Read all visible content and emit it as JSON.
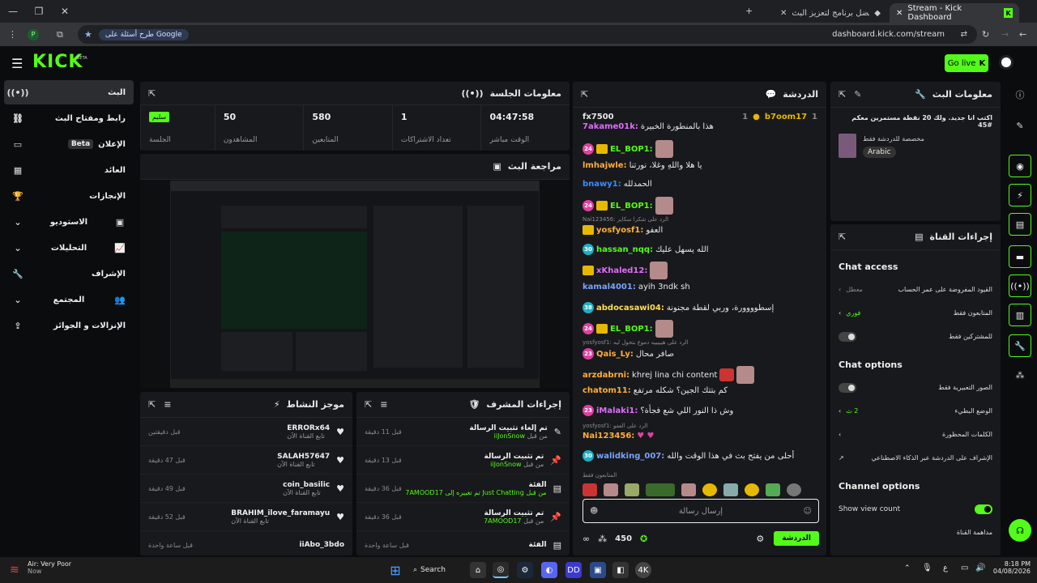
{
  "browser": {
    "tabs": [
      {
        "label": "Stream - Kick Dashboard",
        "active": true
      },
      {
        "label": "الولاء | أفضل برنامج لتعزيز البث",
        "active": false
      }
    ],
    "search_chip": "طرح أسئلة على Google",
    "url": "dashboard.kick.com/stream"
  },
  "header": {
    "logo": "KICK",
    "logo_sup": "BETA",
    "go_live": "Go live"
  },
  "sidebar": {
    "items": [
      {
        "label": "البث",
        "icon": "radio-icon",
        "active": true
      },
      {
        "label": "رابط ومفتاح البث",
        "icon": "link-icon"
      },
      {
        "label": "الإعلان",
        "icon": "ad-icon",
        "badge": "Beta"
      },
      {
        "label": "العائد",
        "icon": "revenue-icon"
      },
      {
        "label": "الإنجازات",
        "icon": "trophy-icon"
      },
      {
        "label": "الاستوديو",
        "icon": "studio-icon",
        "expand": true
      },
      {
        "label": "التحليلات",
        "icon": "chart-icon",
        "expand": true
      },
      {
        "label": "الإشراف",
        "icon": "wrench-icon"
      },
      {
        "label": "المجتمع",
        "icon": "community-icon",
        "expand": true
      },
      {
        "label": "الإنزالات و الجوائز",
        "icon": "gift-icon"
      }
    ]
  },
  "session": {
    "title": "معلومات الجلسة",
    "status_badge": "سليم",
    "status_label": "الجلسة",
    "stats": [
      {
        "value": "04:47:58",
        "label": "الوقت مباشر"
      },
      {
        "value": "1",
        "label": "تعداد الاشتراكات"
      },
      {
        "value": "580",
        "label": "المتابعين"
      },
      {
        "value": "50",
        "label": "المشاهدون"
      }
    ]
  },
  "preview": {
    "title": "مراجعة البث"
  },
  "activity": {
    "title": "موجز النشاط",
    "items": [
      {
        "name": "ERRORx64",
        "sub": "تابع القناة الآن",
        "time": "قبل دقيقتين"
      },
      {
        "name": "SALAH57647",
        "sub": "تابع القناة الآن",
        "time": "قبل 47 دقيقة"
      },
      {
        "name": "coin_basilic",
        "sub": "تابع القناة الآن",
        "time": "قبل 49 دقيقة"
      },
      {
        "name": "BRAHIM_ilove_faramayu",
        "sub": "تابع القناة الآن",
        "time": "قبل 52 دقيقة"
      },
      {
        "name": "iiAbo_3bdo",
        "sub": "",
        "time": "قبل ساعة واحدة"
      }
    ]
  },
  "modactions": {
    "title": "إجراءات المشرف",
    "items": [
      {
        "title": "تم إلغاء تثبيت الرسالة",
        "by": "من قبل",
        "user": "iiJonSnow",
        "time": "قبل 11 دقيقة"
      },
      {
        "title": "تم تثبيت الرسالة",
        "by": "من قبل",
        "user": "iiJonSnow",
        "time": "قبل 13 دقيقة"
      },
      {
        "title": "الفئة",
        "by": "تم تغييره إلى Just Chatting من قبل",
        "user": "7AMOOD17",
        "time": "قبل 36 دقيقة"
      },
      {
        "title": "تم تثبيت الرسالة",
        "by": "من قبل",
        "user": "7AMOOD17",
        "time": "قبل 36 دقيقة"
      },
      {
        "title": "الفئة",
        "by": "",
        "user": "",
        "time": "قبل ساعة واحدة"
      }
    ]
  },
  "chat": {
    "title": "الدردشة",
    "pinned_left": "fx7500",
    "pinned_left_count": "1",
    "pinned_right": "b7oom17",
    "pinned_right_count": "1",
    "messages": [
      {
        "user": "7akame01k:",
        "text": "هذا بالمنطورة الخبيرة",
        "color": "#e26bff"
      },
      {
        "user": "EL_BOP1:",
        "text": "",
        "color": "#53fc18",
        "badge": "24"
      },
      {
        "user": "lmhajwle:",
        "text": "يا هلا واللهِ وغلا، نورتنا",
        "color": "#ffae3b"
      },
      {
        "user": "bnawy1:",
        "text": "الحمدلله",
        "color": "#3b8bff"
      },
      {
        "user": "EL_BOP1:",
        "text": "",
        "color": "#53fc18",
        "badge": "24"
      },
      {
        "user": "yosfyosf1:",
        "text": "العفو",
        "color": "#ffae3b",
        "reply": "Nai123456: الرد على شكرا سكاير"
      },
      {
        "user": "hassan_nqq:",
        "text": "الله يسهل عليك",
        "color": "#53fc18",
        "badge": "30"
      },
      {
        "user": "xKhaled12:",
        "text": "",
        "color": "#e26bff"
      },
      {
        "user": "kamal4001:",
        "text": "ayih 3ndk sh",
        "color": "#7aa2ff"
      },
      {
        "user": "abdocasawi04:",
        "text": "إسطوووورة، وربي لقطة مجنونة",
        "color": "#ffdd55",
        "badge": "38"
      },
      {
        "user": "EL_BOP1:",
        "text": "",
        "color": "#53fc18",
        "badge": "24"
      },
      {
        "user": "Qais_Ly:",
        "text": "صافر محال",
        "color": "#ffae3b",
        "badge": "23",
        "reply": "yosfyosf1: الرد على هيييييه دموع بتحول ليه"
      },
      {
        "user": "arzdabrni:",
        "text": "khrej lina chi content",
        "color": "#ffae3b"
      },
      {
        "user": "chatom11:",
        "text": "كم بتتك الجين؟ شكله مرتفع",
        "color": "#ffae3b"
      },
      {
        "user": "iMalaki1:",
        "text": "وش ذا النور اللي شع فجأة؟",
        "color": "#e26bff",
        "badge": "23"
      },
      {
        "user": "Nai123456:",
        "text": "",
        "color": "#ffae3b",
        "reply": "yosfyosf1: الرد على العفو"
      },
      {
        "user": "walidking_007:",
        "text": "أحلى من يفتح بث في هذا الوقت والله",
        "color": "#7aa2ff",
        "badge": "30"
      }
    ],
    "followers_only": "المتابعون فقط",
    "input_placeholder": "إرسال رسالة",
    "points": "450",
    "send_label": "الدردشة"
  },
  "streaminfo": {
    "title": "معلومات البث",
    "stream_title": "اكتب انا جديد. ولك 20 نقطة مستمرين معكم #45",
    "category": "مخصصة للدردشة فقط",
    "language": "Arabic"
  },
  "channelactions": {
    "title": "إجراءات القناة",
    "chat_access": "Chat access",
    "rows1": [
      {
        "label": "القيود المفروضة على عمر الحساب",
        "value": "معطل"
      },
      {
        "label": "المتابعون فقط",
        "value": "فوري"
      },
      {
        "label": "للمشتركين فقط",
        "value": ""
      }
    ],
    "chat_options": "Chat options",
    "rows2": [
      {
        "label": "الصور التعبيرية فقط",
        "value": ""
      },
      {
        "label": "الوضع البطيء",
        "value": "2 ث"
      },
      {
        "label": "الكلمات المحظورة",
        "value": ""
      },
      {
        "label": "الإشراف على الدردشة عبر الذكاء الاصطناعي",
        "value": ""
      }
    ],
    "channel_options": "Channel options",
    "show_view_count": "Show view count",
    "last_row": "مداهمة القناة"
  },
  "taskbar": {
    "weather": "Air: Very Poor",
    "weather_sub": "Now",
    "search": "Search",
    "time": "8:18 PM",
    "date": "04/08/2026",
    "lang": "ع"
  },
  "colors": {
    "accent": "#53fc18",
    "panel": "#18191c",
    "bg": "#0b0c0e"
  }
}
